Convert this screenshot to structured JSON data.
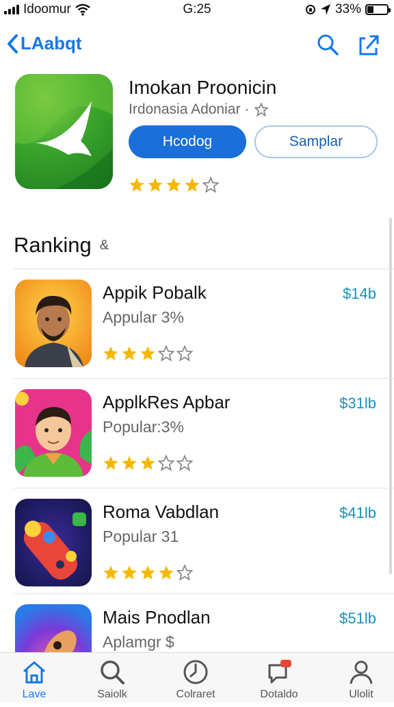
{
  "status_bar": {
    "carrier": "Idoomur",
    "time": "G:25",
    "battery": "33%",
    "battery_level": 0.33
  },
  "nav": {
    "back_label": "LAabqt"
  },
  "featured_app": {
    "title": "Imokan Proonicin",
    "subtitle": "Irdonasia Adoniar ·",
    "primary_button": "Hcodog",
    "secondary_button": "Samplar",
    "rating": 4
  },
  "section": {
    "title": "Ranking",
    "suffix": "&"
  },
  "ranking": [
    {
      "name": "Appik Pobalk",
      "subtitle": "Appular 3%",
      "price": "$14b",
      "rating": 3
    },
    {
      "name": "ApplkRes Apbar",
      "subtitle": "Popular:3%",
      "price": "$31lb",
      "rating": 3
    },
    {
      "name": "Roma Vabdlan",
      "subtitle": "Popular 31",
      "price": "$41lb",
      "rating": 4
    },
    {
      "name": "Mais Pnodlan",
      "subtitle": "Aplamgr $",
      "price": "$51lb",
      "rating": 0
    }
  ],
  "tabs": [
    {
      "label": "Lave",
      "icon": "home-icon",
      "active": true
    },
    {
      "label": "Saiolk",
      "icon": "search-icon",
      "active": false
    },
    {
      "label": "Colraret",
      "icon": "clock-icon",
      "active": false
    },
    {
      "label": "Dotaldo",
      "icon": "chat-badge-icon",
      "active": false
    },
    {
      "label": "Ulolit",
      "icon": "person-icon",
      "active": false
    }
  ],
  "colors": {
    "accent": "#1677e6",
    "star": "#f5b800",
    "price": "#1a8fb8"
  }
}
